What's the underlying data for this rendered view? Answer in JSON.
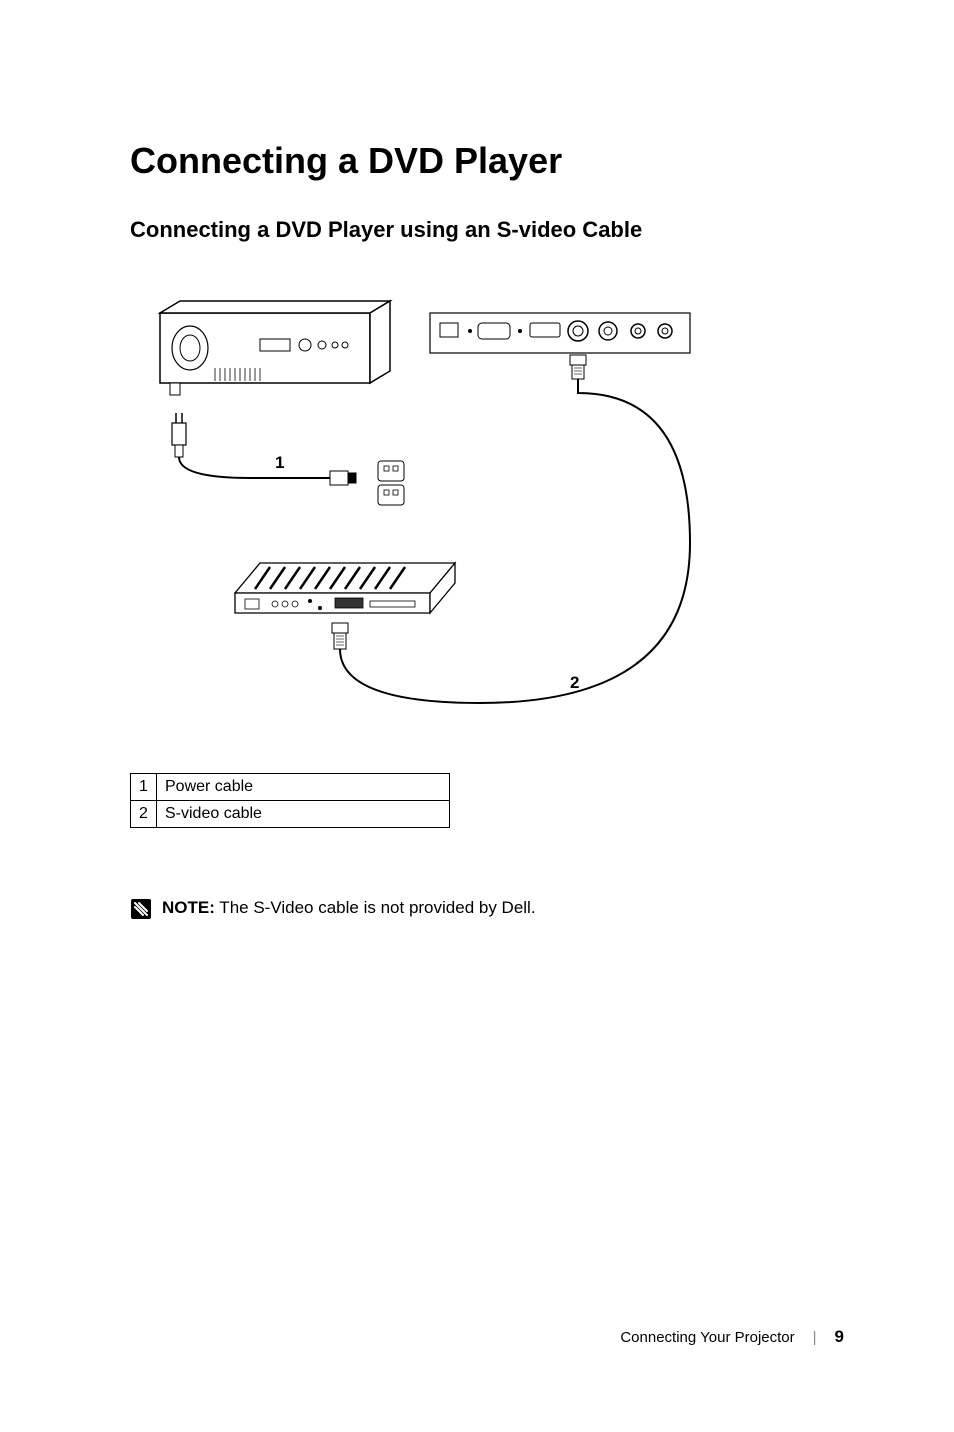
{
  "header": {
    "title": "Connecting a DVD Player",
    "subtitle": "Connecting a DVD Player using an S-video Cable"
  },
  "diagram": {
    "callouts": {
      "one": "1",
      "two": "2"
    }
  },
  "legend": {
    "rows": [
      {
        "num": "1",
        "label": "Power cable"
      },
      {
        "num": "2",
        "label": "S-video cable"
      }
    ]
  },
  "note": {
    "prefix": "NOTE:",
    "text": " The S-Video cable is not provided by Dell."
  },
  "footer": {
    "section": "Connecting Your Projector",
    "page": "9"
  }
}
